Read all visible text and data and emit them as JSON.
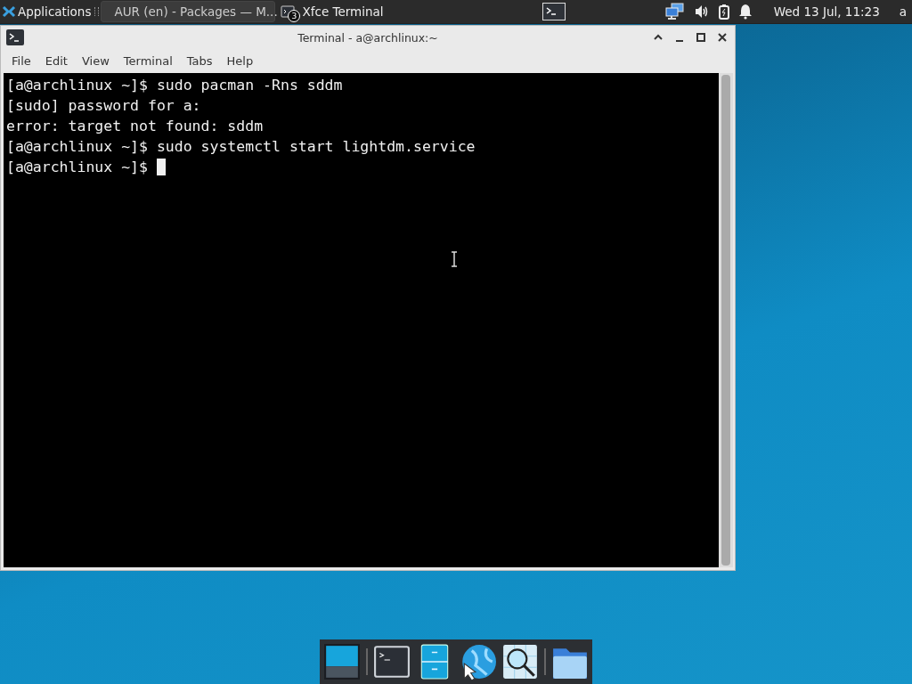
{
  "panel": {
    "menu_label": "Applications",
    "tasks": [
      {
        "label": "AUR (en) - Packages — M...",
        "kind": "browser",
        "selected": true
      },
      {
        "label": "Xfce Terminal",
        "kind": "terminal",
        "badge": "3",
        "selected": false
      }
    ],
    "clock": "Wed 13 Jul, 11:23",
    "user": "a"
  },
  "window": {
    "title": "Terminal - a@archlinux:~",
    "menu": [
      "File",
      "Edit",
      "View",
      "Terminal",
      "Tabs",
      "Help"
    ],
    "lines": [
      "[a@archlinux ~]$ sudo pacman -Rns sddm",
      "[sudo] password for a:",
      "error: target not found: sddm",
      "[a@archlinux ~]$ sudo systemctl start lightdm.service",
      "[a@archlinux ~]$ "
    ],
    "cursor": true
  }
}
